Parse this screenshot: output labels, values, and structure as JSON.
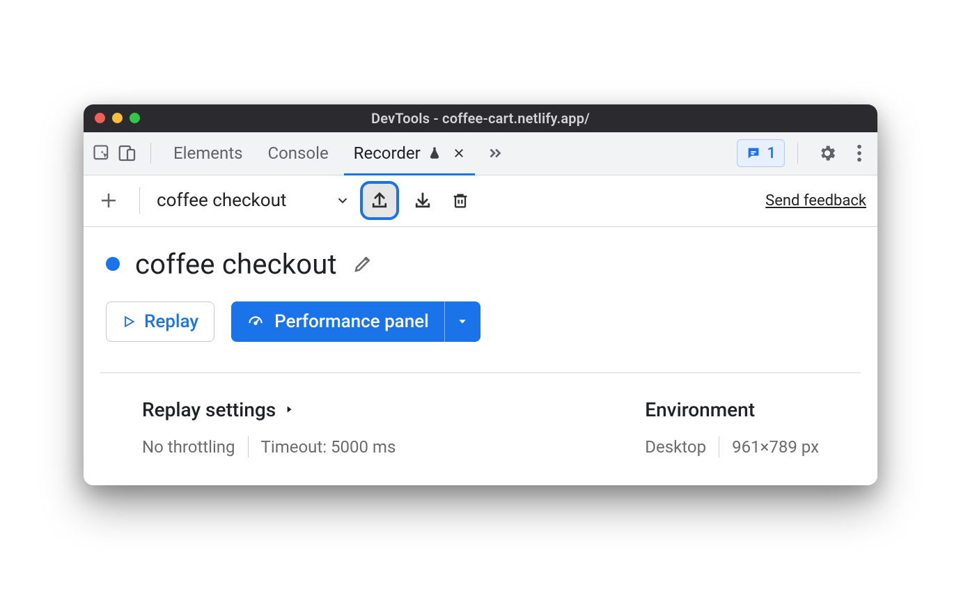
{
  "window": {
    "title": "DevTools - coffee-cart.netlify.app/"
  },
  "tabs": {
    "elements": "Elements",
    "console": "Console",
    "recorder": "Recorder",
    "messages_count": "1"
  },
  "recorder_bar": {
    "selected_recording": "coffee checkout",
    "feedback": "Send feedback"
  },
  "recording": {
    "title": "coffee checkout",
    "replay_label": "Replay",
    "performance_label": "Performance panel"
  },
  "settings": {
    "replay_heading": "Replay settings",
    "throttling": "No throttling",
    "timeout": "Timeout: 5000 ms",
    "env_heading": "Environment",
    "env_device": "Desktop",
    "viewport": "961×789 px"
  }
}
